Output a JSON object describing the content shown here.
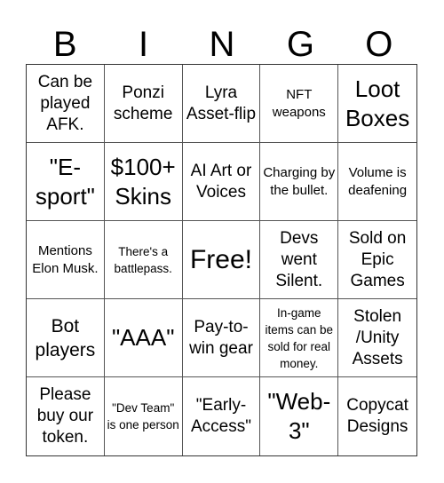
{
  "header": {
    "letters": [
      "B",
      "I",
      "N",
      "G",
      "O"
    ]
  },
  "cells": [
    {
      "text": "Can be played AFK.",
      "size": "md"
    },
    {
      "text": "Ponzi scheme",
      "size": "md"
    },
    {
      "text": "Lyra Asset-flip",
      "size": "md"
    },
    {
      "text": "NFT weapons",
      "size": "sm"
    },
    {
      "text": "Loot Boxes",
      "size": "xl"
    },
    {
      "text": "\"E-sport\"",
      "size": "xl"
    },
    {
      "text": "$100+ Skins",
      "size": "xl"
    },
    {
      "text": "AI Art or Voices",
      "size": "md"
    },
    {
      "text": "Charging by the bullet.",
      "size": "sm"
    },
    {
      "text": "Volume is deafening",
      "size": "sm"
    },
    {
      "text": "Mentions Elon Musk.",
      "size": "sm"
    },
    {
      "text": "There's a battlepass.",
      "size": "xs"
    },
    {
      "text": "Free!",
      "size": "xxl"
    },
    {
      "text": "Devs went Silent.",
      "size": "md"
    },
    {
      "text": "Sold on Epic Games",
      "size": "md"
    },
    {
      "text": "Bot players",
      "size": "lg"
    },
    {
      "text": "\"AAA\"",
      "size": "xl"
    },
    {
      "text": "Pay-to-win gear",
      "size": "md"
    },
    {
      "text": "In-game items can be sold for real money.",
      "size": "xs"
    },
    {
      "text": "Stolen /Unity Assets",
      "size": "md"
    },
    {
      "text": "Please buy our token.",
      "size": "md"
    },
    {
      "text": "\"Dev Team\" is one person",
      "size": "xs"
    },
    {
      "text": "\"Early-Access\"",
      "size": "md"
    },
    {
      "text": "\"Web-3\"",
      "size": "xl"
    },
    {
      "text": "Copycat Designs",
      "size": "md"
    }
  ]
}
